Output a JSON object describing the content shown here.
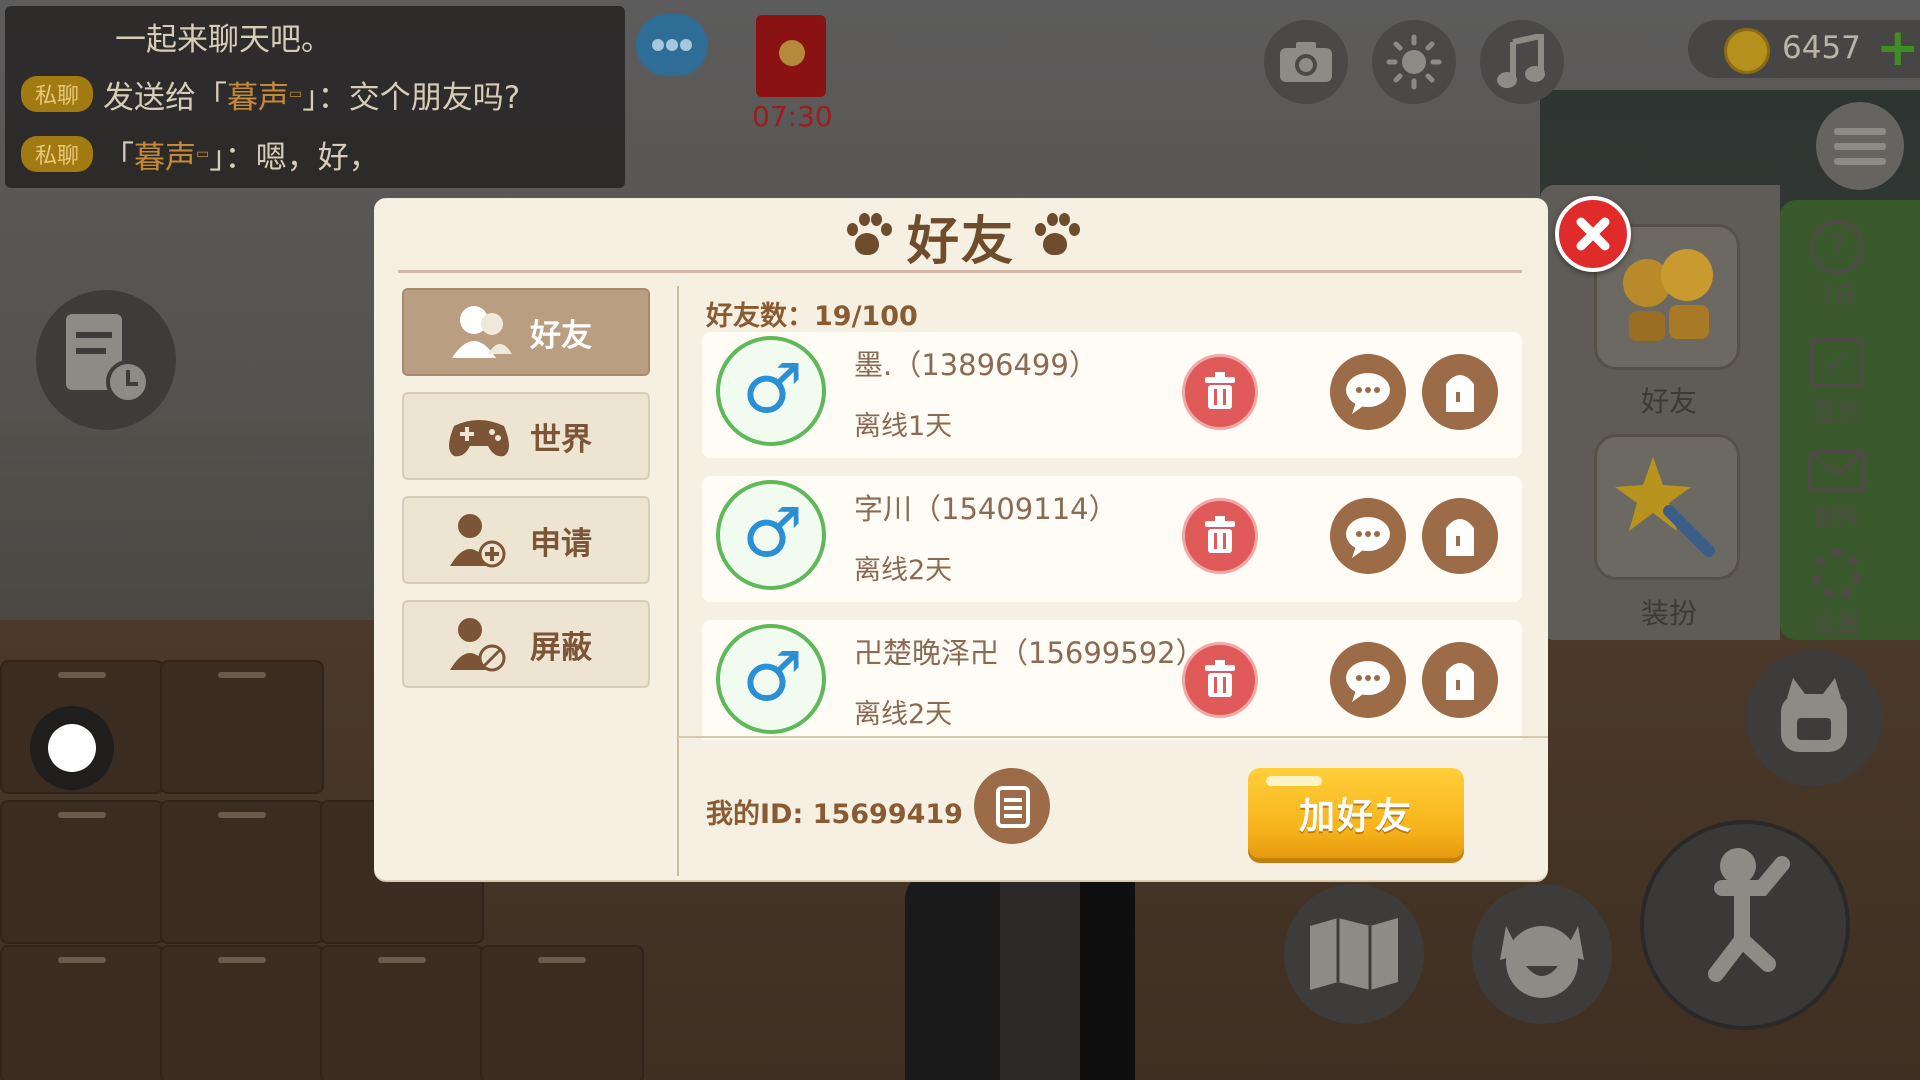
{
  "chat": {
    "lines": [
      {
        "text": "一起来聊天吧。"
      },
      {
        "tag": "私聊",
        "prefix": "发送给「",
        "name": "暮声",
        "suffix": "」：交个朋友吗?"
      },
      {
        "tag": "私聊",
        "prefix": "「",
        "name": "暮声",
        "suffix": "」：嗯，好，"
      }
    ]
  },
  "hud": {
    "red_packet_time": "07:30",
    "coins": "6457"
  },
  "side_menu": {
    "friends_label": "好友",
    "dress_label": "装扮",
    "strip": [
      "7日",
      "签到",
      "邮件",
      "设置"
    ]
  },
  "modal": {
    "title": "好友",
    "tabs": [
      {
        "label": "好友",
        "active": true
      },
      {
        "label": "世界",
        "active": false
      },
      {
        "label": "申请",
        "active": false
      },
      {
        "label": "屏蔽",
        "active": false
      }
    ],
    "friend_count_label": "好友数：",
    "friend_count": "19/100",
    "friends": [
      {
        "name": "墨.（13896499）",
        "status": "离线1天",
        "gender": "male"
      },
      {
        "name": "字川（15409114）",
        "status": "离线2天",
        "gender": "male"
      },
      {
        "name": "卍楚晚泽卍（15699592）",
        "status": "离线2天",
        "gender": "male"
      }
    ],
    "my_id_label": "我的ID:",
    "my_id": "15699419",
    "add_friend_label": "加好友"
  },
  "colors": {
    "accent_brown": "#9c6b47",
    "delete_red": "#e05a5a",
    "gold": "#f7b21a",
    "male_blue": "#2a8fd6"
  }
}
